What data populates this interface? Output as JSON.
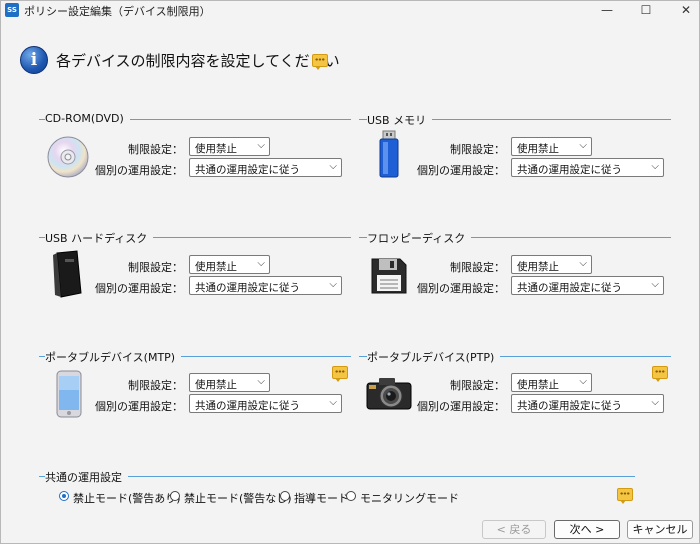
{
  "window": {
    "icon_text": "SS",
    "title": "ポリシー設定編集（デバイス制限用）",
    "minimize": "—",
    "maximize": "☐",
    "close": "✕"
  },
  "header": {
    "info_glyph": "i",
    "text": "各デバイスの制限内容を設定してください"
  },
  "labels": {
    "restriction": "制限設定：",
    "individual": "個別の運用設定："
  },
  "devices": [
    {
      "name": "CD-ROM(DVD)",
      "restriction": "使用禁止",
      "individual": "共通の運用設定に従う"
    },
    {
      "name": "USB メモリ",
      "restriction": "使用禁止",
      "individual": "共通の運用設定に従う"
    },
    {
      "name": "USB ハードディスク",
      "restriction": "使用禁止",
      "individual": "共通の運用設定に従う"
    },
    {
      "name": "フロッピーディスク",
      "restriction": "使用禁止",
      "individual": "共通の運用設定に従う"
    },
    {
      "name": "ポータブルデバイス(MTP)",
      "restriction": "使用禁止",
      "individual": "共通の運用設定に従う"
    },
    {
      "name": "ポータブルデバイス(PTP)",
      "restriction": "使用禁止",
      "individual": "共通の運用設定に従う"
    }
  ],
  "common": {
    "title": "共通の運用設定",
    "options": [
      {
        "label": "禁止モード(警告あり)",
        "selected": true
      },
      {
        "label": "禁止モード(警告なし)",
        "selected": false
      },
      {
        "label": "指導モード",
        "selected": false
      },
      {
        "label": "モニタリングモード",
        "selected": false
      }
    ]
  },
  "footer": {
    "back": "< 戻る",
    "next": "次へ >",
    "cancel": "キャンセル"
  },
  "icons": {
    "app": "app-icon",
    "info": "info-icon",
    "comment": "comment-icon",
    "cd": "cd-disc-icon",
    "usb": "usb-memory-icon",
    "hdd": "external-hdd-icon",
    "floppy": "floppy-disk-icon",
    "phone": "smartphone-icon",
    "camera": "camera-icon"
  },
  "colors": {
    "accent": "#1f6fc5",
    "group_line": "#5aa0d8",
    "comment": "#f4c542"
  }
}
